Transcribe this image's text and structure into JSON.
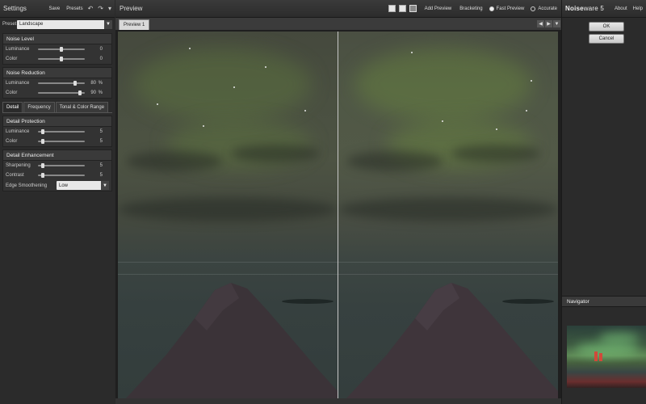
{
  "left": {
    "title": "Settings",
    "save": "Save",
    "presets": "Presets",
    "undo_icon": "undo-icon",
    "redo_icon": "redo-icon",
    "menu_icon": "menu-icon",
    "preset_label": "Preset",
    "preset_value": "Landscape",
    "noise_level": {
      "title": "Noise Level",
      "luminance": {
        "label": "Luminance",
        "value": "0",
        "level": 0.5
      },
      "color": {
        "label": "Color",
        "value": "0",
        "level": 0.5
      }
    },
    "noise_reduction": {
      "title": "Noise Reduction",
      "luminance": {
        "label": "Luminance",
        "value": "80",
        "unit": "%",
        "level": 0.8
      },
      "color": {
        "label": "Color",
        "value": "90",
        "unit": "%",
        "level": 0.9
      }
    },
    "tabs": [
      "Detail",
      "Frequency",
      "Tonal & Color Range"
    ],
    "detail_protection": {
      "title": "Detail Protection",
      "luminance": {
        "label": "Luminance",
        "value": "5",
        "level": 0.1
      },
      "color": {
        "label": "Color",
        "value": "5",
        "level": 0.1
      }
    },
    "detail_enhancement": {
      "title": "Detail Enhancement",
      "sharpening": {
        "label": "Sharpening",
        "value": "5",
        "level": 0.1
      },
      "contrast": {
        "label": "Contrast",
        "value": "5",
        "level": 0.1
      },
      "edge": {
        "label": "Edge Smoothening",
        "value": "Low"
      }
    }
  },
  "center": {
    "title": "Preview",
    "add_preview": "Add Preview",
    "bracketing": "Bracketing",
    "fast_preview": "Fast Preview",
    "accurate": "Accurate",
    "tab": "Preview 1"
  },
  "right": {
    "brand_bold": "Noise",
    "brand_rest": "ware 5",
    "about": "About",
    "help": "Help",
    "ok": "OK",
    "cancel": "Cancel",
    "navigator": "Navigator"
  },
  "colors": {
    "accent": "#e6e6e6",
    "panel": "#2b2b2b"
  }
}
